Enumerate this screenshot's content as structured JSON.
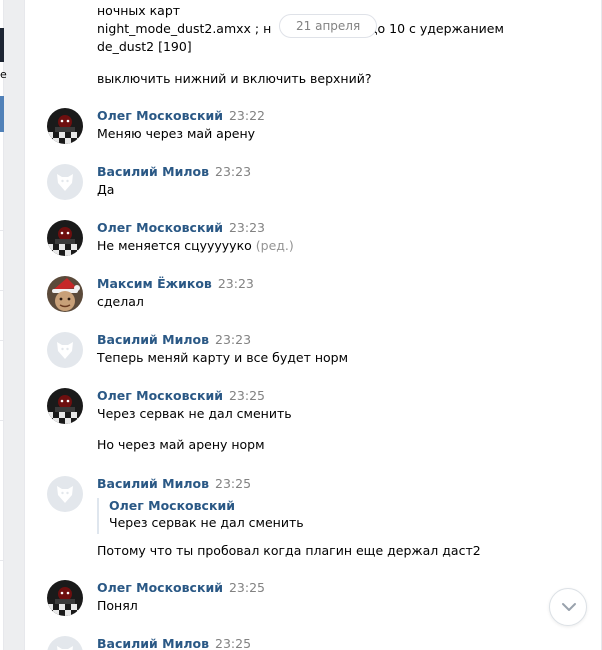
{
  "date_divider": "21 апреля",
  "previous_message": {
    "lines": [
      "ночных карт",
      "night_mode_dust2.amxx ; н",
      "23 до 10 с удержанием",
      "de_dust2 [190]",
      "выключить нижний и включить верхний?"
    ]
  },
  "left_panel": {
    "glyph": "е"
  },
  "messages": [
    {
      "author": "Олег Московский",
      "time": "23:22",
      "avatar": "checkered-dark",
      "lines": [
        "Меняю через май арену"
      ]
    },
    {
      "author": "Василий Милов",
      "time": "23:23",
      "avatar": "default-dog",
      "lines": [
        "Да"
      ]
    },
    {
      "author": "Олег Московский",
      "time": "23:23",
      "avatar": "checkered-dark",
      "lines": [
        "Не меняется сцууууyко"
      ],
      "edited": "(ред.)"
    },
    {
      "author": "Максим Ёжиков",
      "time": "23:23",
      "avatar": "santa-photo",
      "lines": [
        "сделал"
      ]
    },
    {
      "author": "Василий Милов",
      "time": "23:23",
      "avatar": "default-dog",
      "lines": [
        "Теперь меняй карту и все будет норм"
      ]
    },
    {
      "author": "Олег Московский",
      "time": "23:25",
      "avatar": "checkered-dark",
      "lines": [
        "Через сервак не дал сменить",
        "Но через май арену норм"
      ]
    },
    {
      "author": "Василий Милов",
      "time": "23:25",
      "avatar": "default-dog",
      "quote": {
        "author": "Олег Московский",
        "text": "Через сервак не дал сменить"
      },
      "lines": [
        "Потому что ты пробовал когда плагин еще держал даст2"
      ]
    },
    {
      "author": "Олег Московский",
      "time": "23:25",
      "avatar": "checkered-dark",
      "lines": [
        "Понял"
      ]
    },
    {
      "author": "Василий Милов",
      "time": "23:25",
      "avatar": "default-dog",
      "lines": []
    }
  ],
  "colors": {
    "name": "#2a5885",
    "time": "#828282",
    "background": "#edeef0",
    "panel": "#ffffff"
  },
  "scroll_button_icon": "chevron-down-icon"
}
